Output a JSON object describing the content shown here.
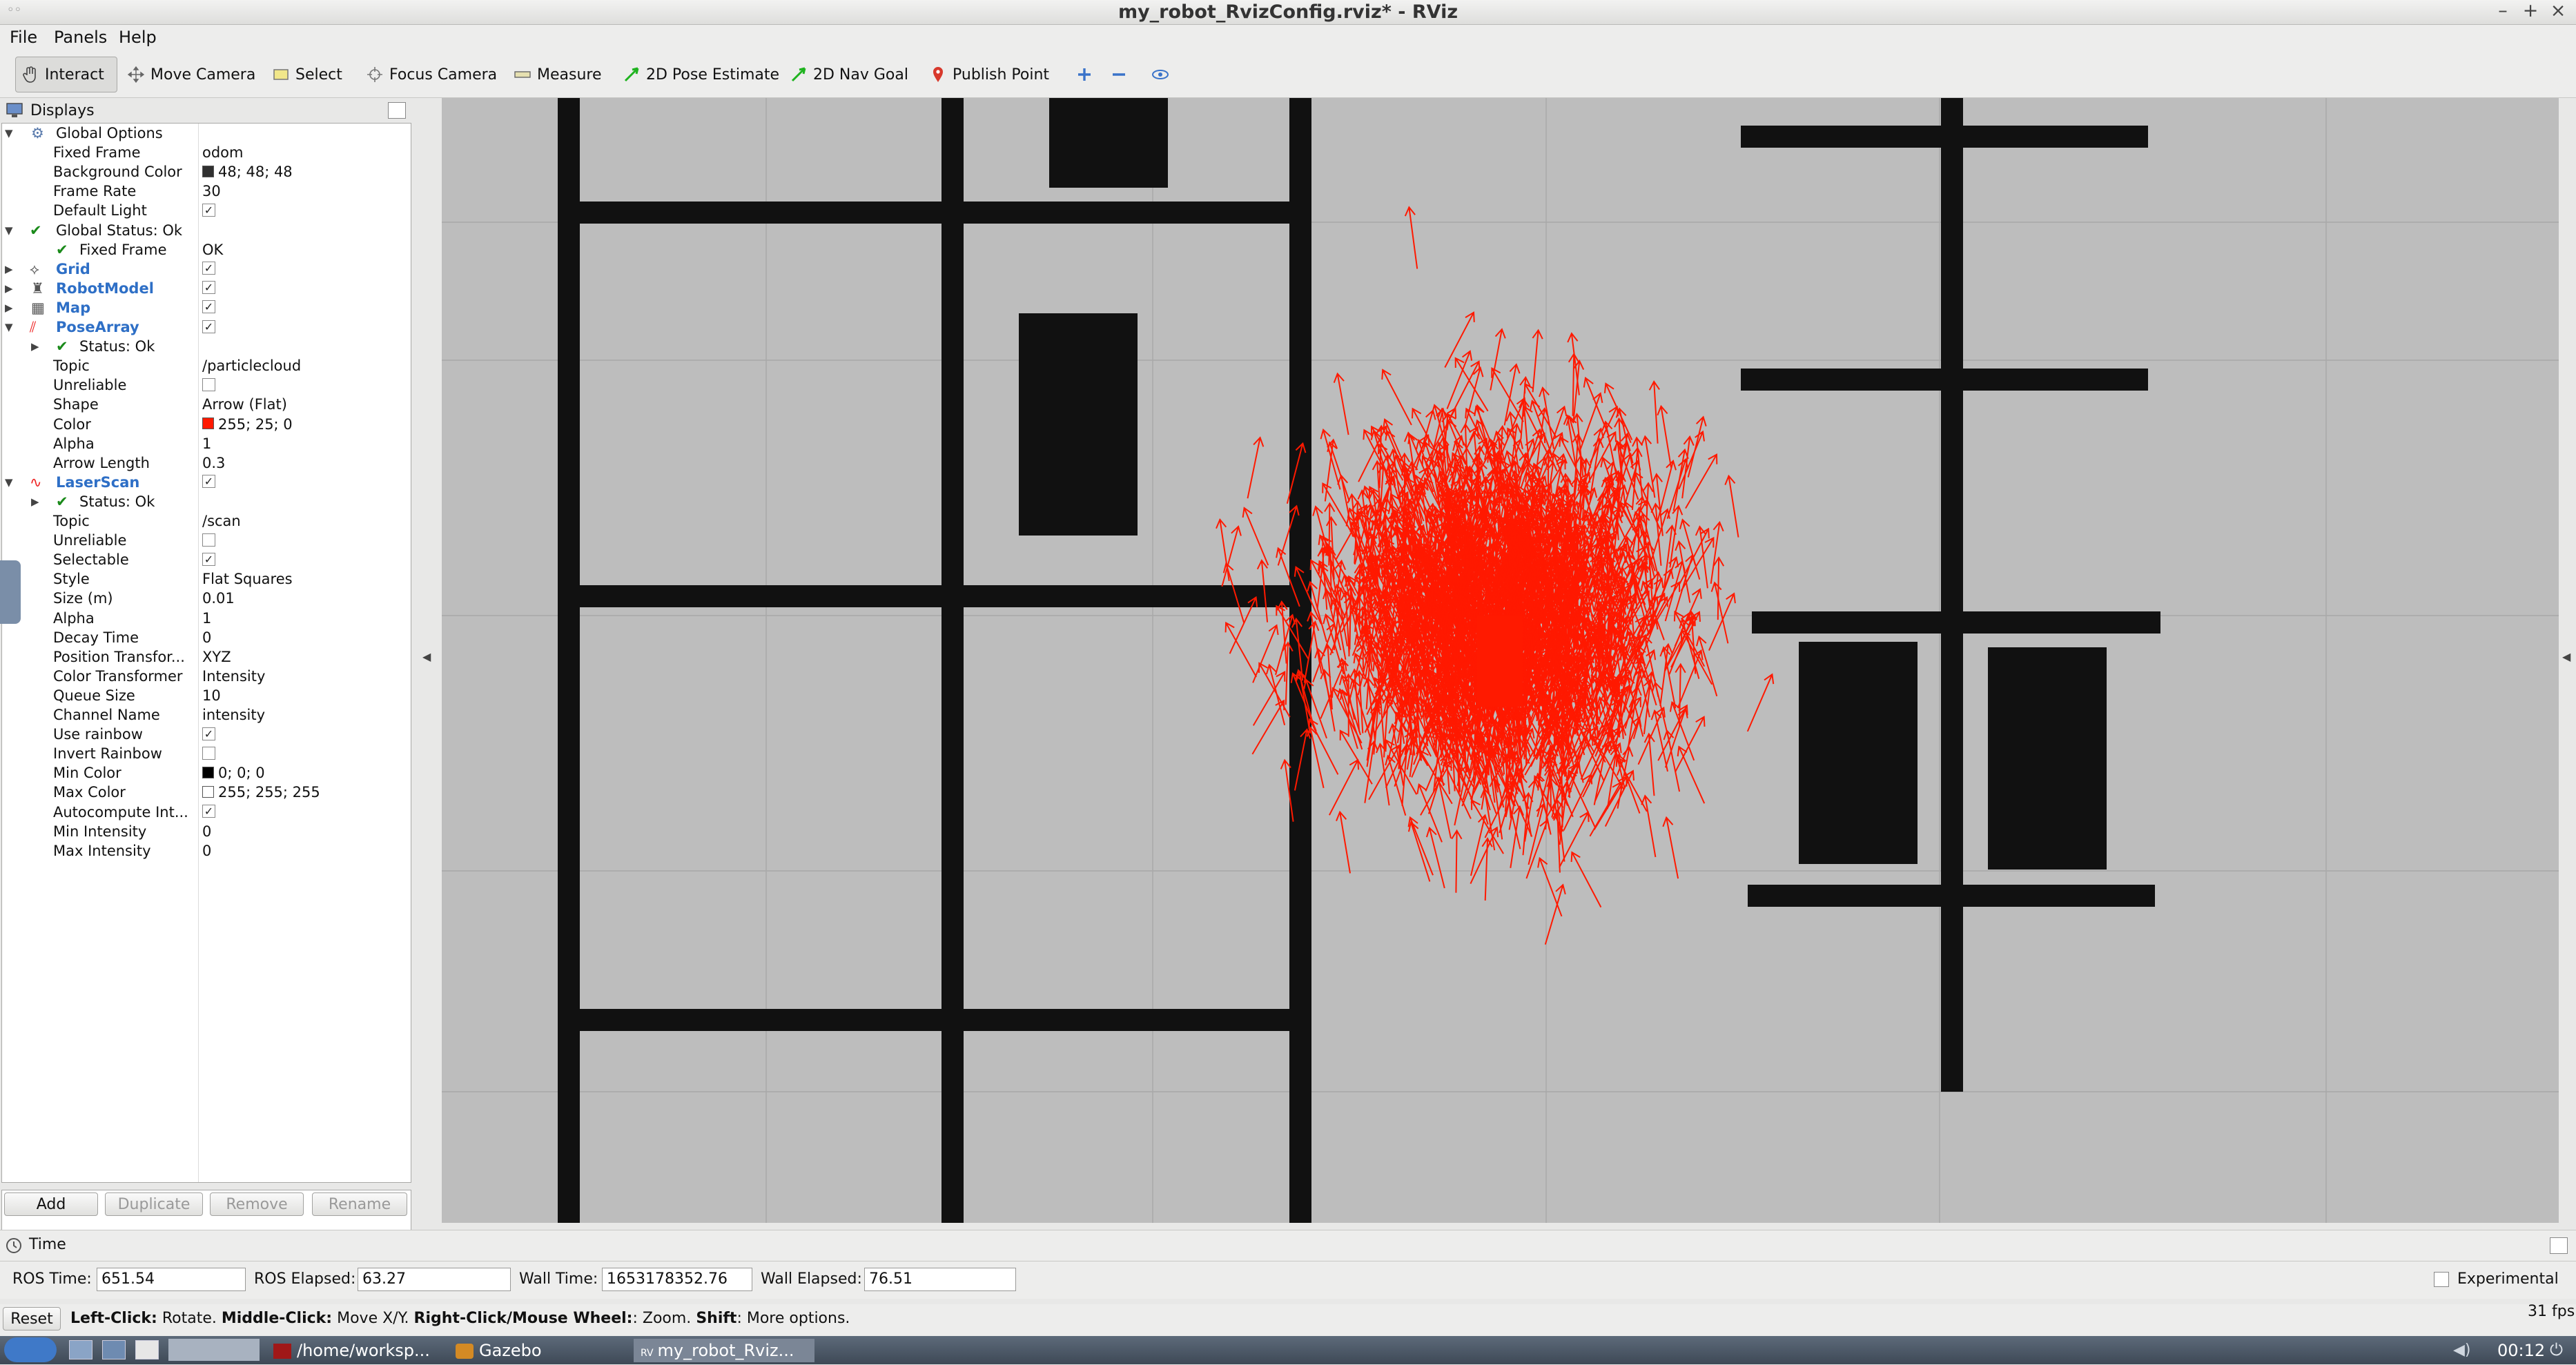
{
  "window": {
    "title": "my_robot_RvizConfig.rviz* - RViz"
  },
  "menu": {
    "file": "File",
    "panels": "Panels",
    "help": "Help"
  },
  "toolbar": {
    "interact": "Interact",
    "move_camera": "Move Camera",
    "select": "Select",
    "focus_camera": "Focus Camera",
    "measure": "Measure",
    "pose_estimate": "2D Pose Estimate",
    "nav_goal": "2D Nav Goal",
    "publish_point": "Publish Point"
  },
  "displays": {
    "title": "Displays",
    "rows": [
      {
        "name": "Global Options",
        "value": ""
      },
      {
        "name": "Fixed Frame",
        "value": "odom"
      },
      {
        "name": "Background Color",
        "value": "48; 48; 48"
      },
      {
        "name": "Frame Rate",
        "value": "30"
      },
      {
        "name": "Default Light",
        "value": ""
      },
      {
        "name": "Global Status: Ok",
        "value": ""
      },
      {
        "name": "Fixed Frame",
        "value": "OK"
      },
      {
        "name": "Grid",
        "value": ""
      },
      {
        "name": "RobotModel",
        "value": ""
      },
      {
        "name": "Map",
        "value": ""
      },
      {
        "name": "PoseArray",
        "value": ""
      },
      {
        "name": "Status: Ok",
        "value": ""
      },
      {
        "name": "Topic",
        "value": "/particlecloud"
      },
      {
        "name": "Unreliable",
        "value": ""
      },
      {
        "name": "Shape",
        "value": "Arrow (Flat)"
      },
      {
        "name": "Color",
        "value": "255; 25; 0"
      },
      {
        "name": "Alpha",
        "value": "1"
      },
      {
        "name": "Arrow Length",
        "value": "0.3"
      },
      {
        "name": "LaserScan",
        "value": ""
      },
      {
        "name": "Status: Ok",
        "value": ""
      },
      {
        "name": "Topic",
        "value": "/scan"
      },
      {
        "name": "Unreliable",
        "value": ""
      },
      {
        "name": "Selectable",
        "value": ""
      },
      {
        "name": "Style",
        "value": "Flat Squares"
      },
      {
        "name": "Size (m)",
        "value": "0.01"
      },
      {
        "name": "Alpha",
        "value": "1"
      },
      {
        "name": "Decay Time",
        "value": "0"
      },
      {
        "name": "Position Transfor...",
        "value": "XYZ"
      },
      {
        "name": "Color Transformer",
        "value": "Intensity"
      },
      {
        "name": "Queue Size",
        "value": "10"
      },
      {
        "name": "Channel Name",
        "value": "intensity"
      },
      {
        "name": "Use rainbow",
        "value": ""
      },
      {
        "name": "Invert Rainbow",
        "value": ""
      },
      {
        "name": "Min Color",
        "value": "0; 0; 0"
      },
      {
        "name": "Max Color",
        "value": "255; 255; 255"
      },
      {
        "name": "Autocompute Int...",
        "value": ""
      },
      {
        "name": "Min Intensity",
        "value": "0"
      },
      {
        "name": "Max Intensity",
        "value": "0"
      }
    ],
    "buttons": {
      "add": "Add",
      "duplicate": "Duplicate",
      "remove": "Remove",
      "rename": "Rename"
    }
  },
  "colors": {
    "background": "#303030",
    "pose_array": "#ff1900",
    "min_color": "#000000",
    "max_color": "#ffffff"
  },
  "time": {
    "title": "Time",
    "ros_time_label": "ROS Time:",
    "ros_time": "651.54",
    "ros_elapsed_label": "ROS Elapsed:",
    "ros_elapsed": "63.27",
    "wall_time_label": "Wall Time:",
    "wall_time": "1653178352.76",
    "wall_elapsed_label": "Wall Elapsed:",
    "wall_elapsed": "76.51",
    "experimental": "Experimental"
  },
  "status": {
    "reset": "Reset",
    "left_click": "Left-Click:",
    "left_click_text": " Rotate. ",
    "middle_click": "Middle-Click:",
    "middle_click_text": " Move X/Y. ",
    "right_click": "Right-Click/Mouse Wheel:",
    "right_click_text": ": Zoom. ",
    "shift": "Shift",
    "shift_text": ": More options.",
    "fps": "31 fps"
  },
  "taskbar": {
    "terminal": "/home/worksp...",
    "gazebo": "Gazebo",
    "rviz": "my_robot_Rviz...",
    "clock": "00:12"
  }
}
